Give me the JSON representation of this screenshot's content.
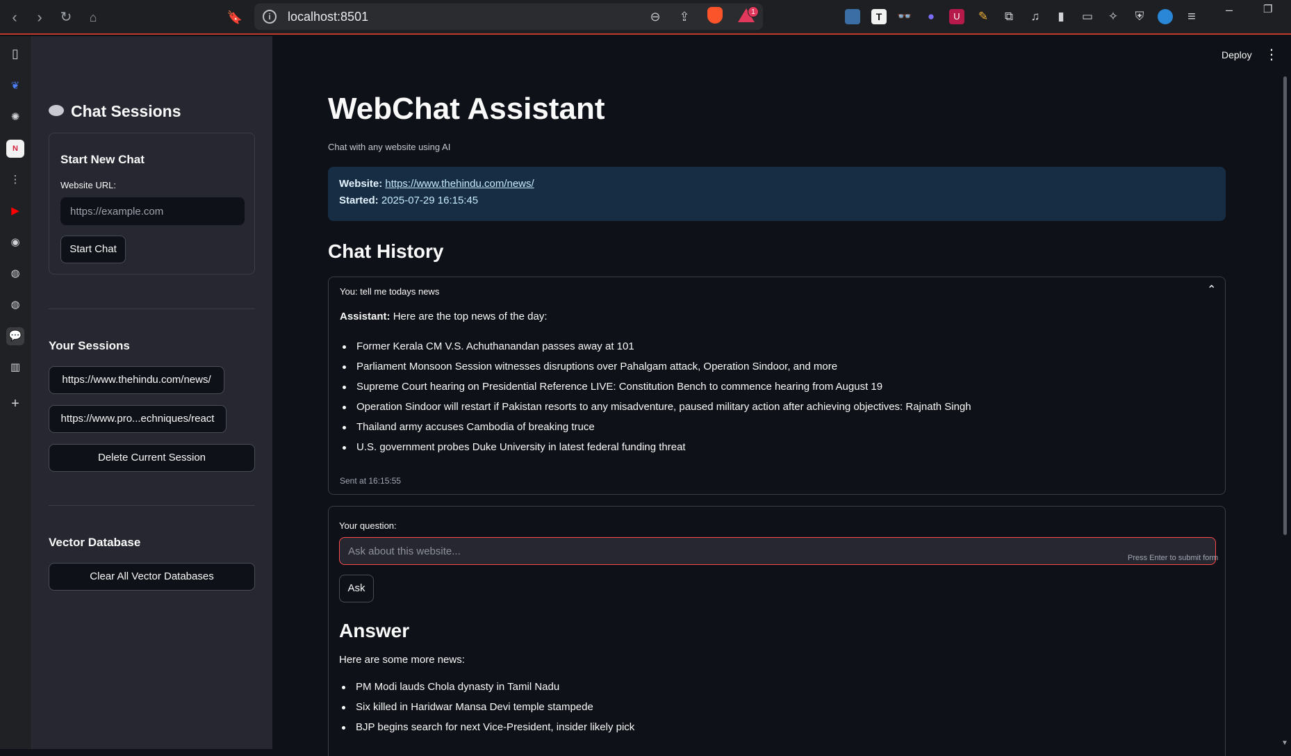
{
  "browser": {
    "url": "localhost:8501",
    "alert_count": "1"
  },
  "sidebar": {
    "title": "Chat Sessions",
    "new_chat": {
      "heading": "Start New Chat",
      "url_label": "Website URL:",
      "url_placeholder": "https://example.com",
      "start_button": "Start Chat"
    },
    "sessions_heading": "Your Sessions",
    "sessions": [
      "https://www.thehindu.com/news/",
      "https://www.pro...echniques/react"
    ],
    "delete_button": "Delete Current Session",
    "vector_heading": "Vector Database",
    "clear_button": "Clear All Vector Databases"
  },
  "header": {
    "deploy": "Deploy"
  },
  "main": {
    "title": "WebChat Assistant",
    "subtitle": "Chat with any website using AI",
    "info": {
      "website_label": "Website:",
      "website_url": "https://www.thehindu.com/news/",
      "started_label": "Started:",
      "started_value": "2025-07-29 16:15:45"
    },
    "history_heading": "Chat History",
    "history": {
      "question": "You: tell me todays news",
      "assistant_label": "Assistant:",
      "assistant_intro": "Here are the top news of the day:",
      "items": [
        "Former Kerala CM V.S. Achuthanandan passes away at 101",
        "Parliament Monsoon Session witnesses disruptions over Pahalgam attack, Operation Sindoor, and more",
        "Supreme Court hearing on Presidential Reference LIVE: Constitution Bench to commence hearing from August 19",
        "Operation Sindoor will restart if Pakistan resorts to any misadventure, paused military action after achieving objectives: Rajnath Singh",
        "Thailand army accuses Cambodia of breaking truce",
        "U.S. government probes Duke University in latest federal funding threat"
      ],
      "sent": "Sent at 16:15:55"
    },
    "form": {
      "label": "Your question:",
      "placeholder": "Ask about this website...",
      "hint": "Press Enter to submit form",
      "ask_button": "Ask"
    },
    "answer": {
      "heading": "Answer",
      "intro": "Here are some more news:",
      "items": [
        "PM Modi lauds Chola dynasty in Tamil Nadu",
        "Six killed in Haridwar Mansa Devi temple stampede",
        "BJP begins search for next Vice-President, insider likely pick"
      ]
    }
  }
}
